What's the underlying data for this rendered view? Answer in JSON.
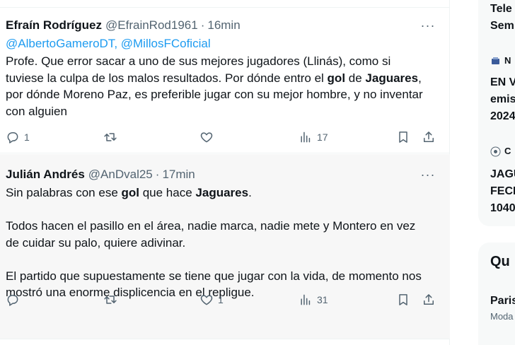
{
  "tweets": [
    {
      "author_name": "Efraín Rodríguez",
      "author_handle": "@EfrainRod1961",
      "separator": "·",
      "time": "16min",
      "more_label": "···",
      "mentions": [
        "@AlbertoGameroDT",
        "@MillosFCoficial"
      ],
      "mention_separator": ", ",
      "body": {
        "p1_a": "Profe. Que error sacar a uno de sus mejores  jugadores (Llinás), como si tuviese la culpa de los malos resultados. Por dónde entro el ",
        "p1_b": "gol",
        "p1_c": " de ",
        "p1_d": "Jaguares",
        "p1_e": ", por dónde Moreno Paz, es preferible jugar con su mejor hombre, y no inventar con alguien"
      },
      "actions": {
        "replies": "1",
        "retweets": "",
        "likes": "",
        "views": "17"
      }
    },
    {
      "author_name": "Julián Andrés",
      "author_handle": "@AnDval25",
      "separator": "·",
      "time": "17min",
      "more_label": "···",
      "body": {
        "p1_a": "Sin palabras con ese ",
        "p1_b": "gol",
        "p1_c": " que hace ",
        "p1_d": "Jaguares",
        "p1_e": ".",
        "p2": "Todos hacen el pasillo en el área, nadie marca, nadie mete y Montero en vez de cuidar su palo, quiere adivinar.",
        "p3": "El partido que supuestamente se tiene que jugar con la vida, de momento nos mostró una enorme displicencia en el repligue."
      },
      "actions": {
        "replies": "",
        "retweets": "",
        "likes": "1",
        "views": "31"
      }
    }
  ],
  "sidebar": {
    "card1": {
      "line1": "Tele",
      "line2": "Sem",
      "news1_label": "N",
      "news1_line1": "EN V",
      "news1_line2": "emis",
      "news1_line3": "2024",
      "news2_label": "C",
      "news2_line1": "JAGU",
      "news2_line2": "FECH",
      "news2_line3": "1040"
    },
    "card2": {
      "heading": "Qu",
      "item1_title": "Paris",
      "item1_sub": "Moda"
    }
  },
  "colors": {
    "text": "#0f1419",
    "secondary": "#536471",
    "link": "#1d9bf0",
    "highlight_bg": "#f7f7f7"
  }
}
